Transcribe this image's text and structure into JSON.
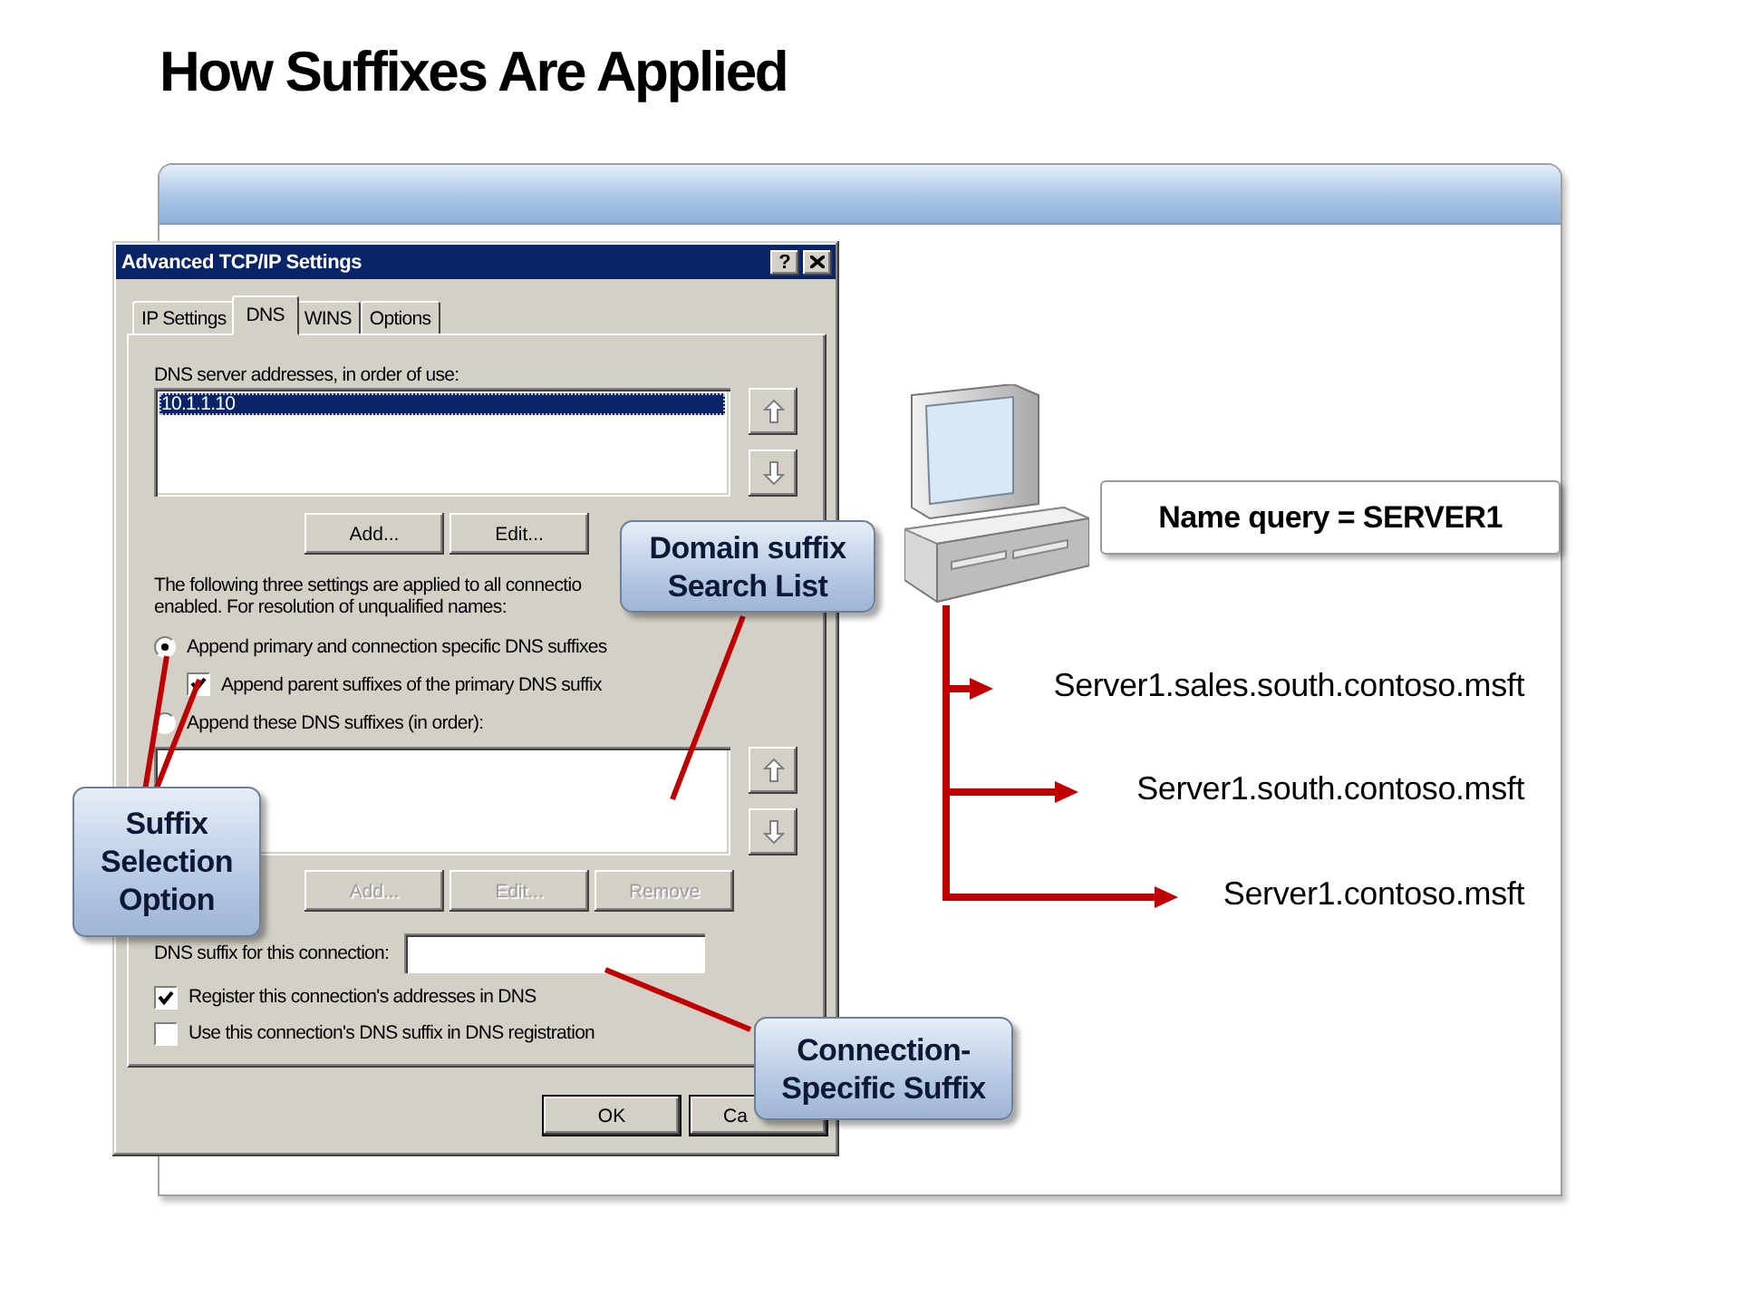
{
  "title": "How Suffixes Are Applied",
  "dialog": {
    "title": "Advanced TCP/IP Settings",
    "help_button": "?",
    "tabs": [
      {
        "label": "IP Settings",
        "selected": false
      },
      {
        "label": "DNS",
        "selected": true
      },
      {
        "label": "WINS",
        "selected": false
      },
      {
        "label": "Options",
        "selected": false
      }
    ],
    "server_list": {
      "label": "DNS server addresses, in order of use:",
      "items": [
        {
          "text": "10.1.1.10",
          "selected": true
        }
      ]
    },
    "server_move_buttons": [
      {
        "kind": "up",
        "disabled": true
      },
      {
        "kind": "down",
        "disabled": true
      }
    ],
    "server_buttons": [
      {
        "label": "Add...",
        "disabled": false
      },
      {
        "label": "Edit...",
        "disabled": false
      }
    ],
    "description_lines": [
      "The following three settings are applied to all connectio",
      "enabled. For resolution of unqualified names:"
    ],
    "options": [
      {
        "kind": "radio",
        "label": "Append primary and connection specific DNS suffixes",
        "selected": true
      },
      {
        "kind": "checkbox",
        "label": "Append parent suffixes of the primary DNS suffix",
        "checked": true
      },
      {
        "kind": "radio",
        "label": "Append these DNS suffixes (in order):",
        "selected": false
      }
    ],
    "suffix_move_buttons": [
      {
        "kind": "up",
        "disabled": true
      },
      {
        "kind": "down",
        "disabled": true
      }
    ],
    "suffix_buttons": [
      {
        "label": "Add...",
        "disabled": true
      },
      {
        "label": "Edit...",
        "disabled": true
      },
      {
        "label": "Remove",
        "disabled": true
      }
    ],
    "suffix_field": {
      "label": "DNS suffix for this connection:"
    },
    "checkboxes": [
      {
        "label": "Register this connection's addresses in DNS",
        "checked": true
      },
      {
        "label": "Use this connection's DNS suffix in DNS registration",
        "checked": false
      }
    ],
    "footer_buttons": [
      {
        "label": "OK"
      },
      {
        "label": "Ca"
      }
    ]
  },
  "callouts": [
    {
      "lines": [
        "Domain suffix",
        "Search List"
      ]
    },
    {
      "lines": [
        "Suffix",
        "Selection",
        "Option"
      ]
    },
    {
      "lines": [
        "Connection-",
        "Specific Suffix"
      ]
    }
  ],
  "diagram": {
    "query": "Name query = SERVER1",
    "lookups": [
      "Server1.sales.south.contoso.msft",
      "Server1.south.contoso.msft",
      "Server1.contoso.msft"
    ]
  }
}
